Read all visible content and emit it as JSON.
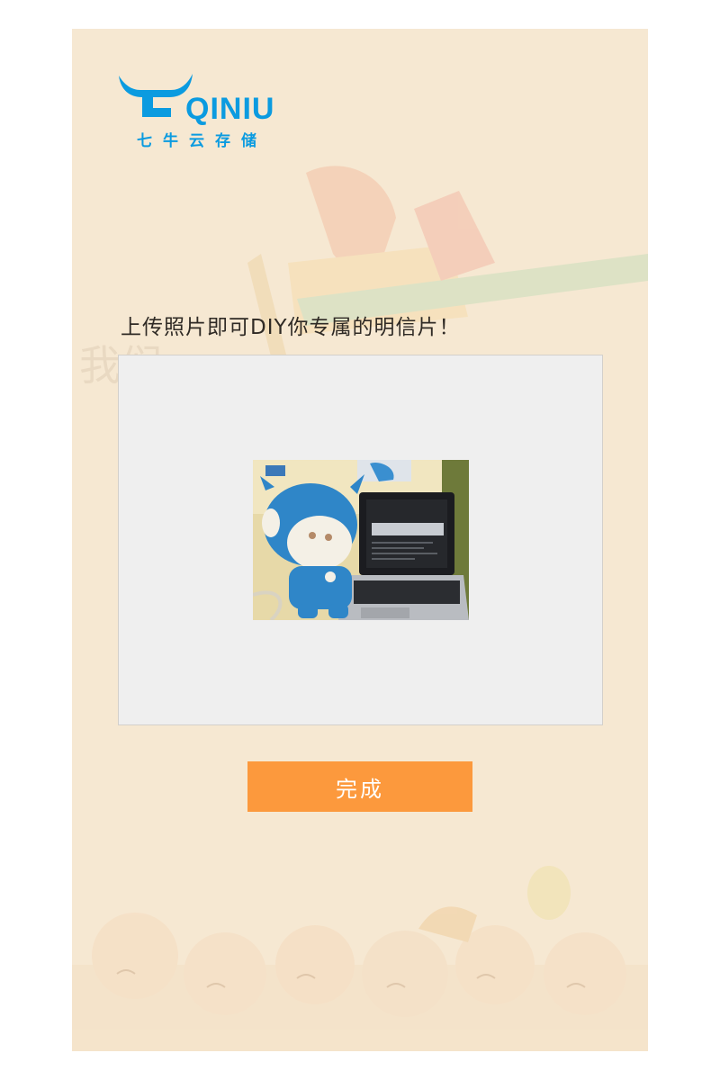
{
  "brand": {
    "logo_word": "QINIU",
    "logo_cn": "七牛云存储",
    "color": "#0b9be0"
  },
  "headline": "上传照片即可DIY你专属的明信片！",
  "upload": {
    "preview_alt": "上传的照片"
  },
  "actions": {
    "done_label": "完成",
    "done_color": "#fc993d"
  },
  "colors": {
    "card_background": "#f6e8d2",
    "upload_background": "#efefef"
  }
}
